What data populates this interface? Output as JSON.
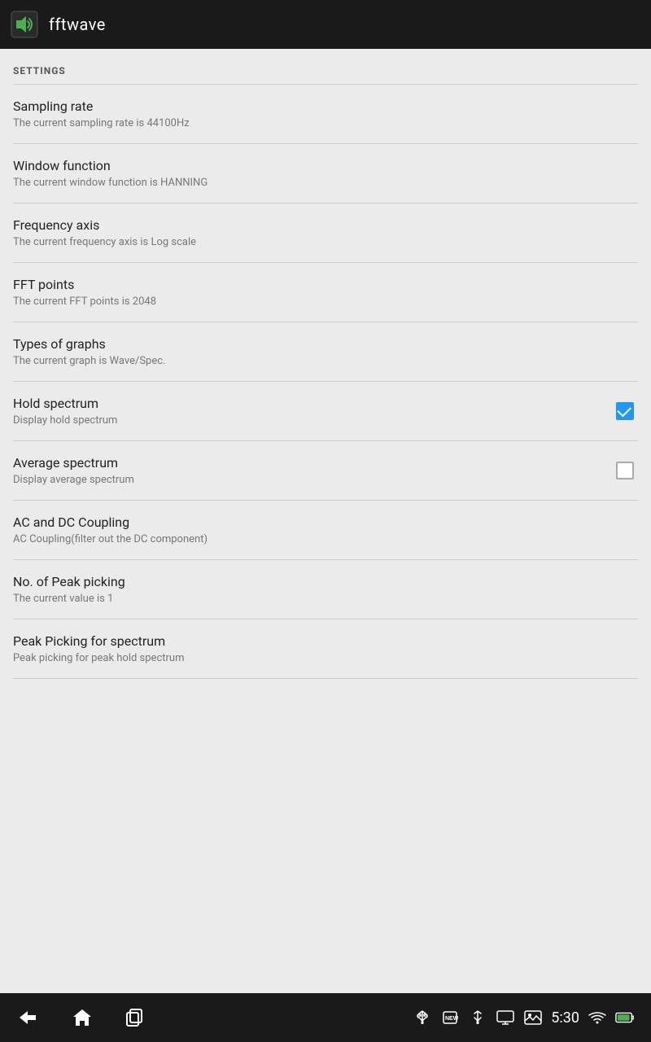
{
  "appBar": {
    "title": "fftwave",
    "iconAlt": "fftwave-app-icon"
  },
  "settings": {
    "sectionLabel": "SETTINGS",
    "items": [
      {
        "id": "sampling-rate",
        "title": "Sampling rate",
        "subtitle": "The current sampling rate is 44100Hz",
        "hasCheckbox": false
      },
      {
        "id": "window-function",
        "title": "Window function",
        "subtitle": "The current window function is HANNING",
        "hasCheckbox": false
      },
      {
        "id": "frequency-axis",
        "title": "Frequency axis",
        "subtitle": "The current frequency axis is Log scale",
        "hasCheckbox": false
      },
      {
        "id": "fft-points",
        "title": "FFT points",
        "subtitle": "The current FFT points is 2048",
        "hasCheckbox": false
      },
      {
        "id": "types-of-graphs",
        "title": "Types of graphs",
        "subtitle": "The current graph is Wave/Spec.",
        "hasCheckbox": false
      },
      {
        "id": "hold-spectrum",
        "title": "Hold spectrum",
        "subtitle": "Display hold spectrum",
        "hasCheckbox": true,
        "checked": true
      },
      {
        "id": "average-spectrum",
        "title": "Average spectrum",
        "subtitle": "Display average spectrum",
        "hasCheckbox": true,
        "checked": false
      },
      {
        "id": "ac-dc-coupling",
        "title": "AC and DC Coupling",
        "subtitle": "AC Coupling(filter out the DC component)",
        "hasCheckbox": false
      },
      {
        "id": "peak-picking",
        "title": "No. of Peak picking",
        "subtitle": "The current value is 1",
        "hasCheckbox": false
      },
      {
        "id": "peak-picking-spectrum",
        "title": "Peak Picking for spectrum",
        "subtitle": "Peak picking for peak hold spectrum",
        "hasCheckbox": false
      }
    ]
  },
  "navBar": {
    "time": "5:30",
    "backLabel": "back",
    "homeLabel": "home",
    "recentLabel": "recent"
  }
}
